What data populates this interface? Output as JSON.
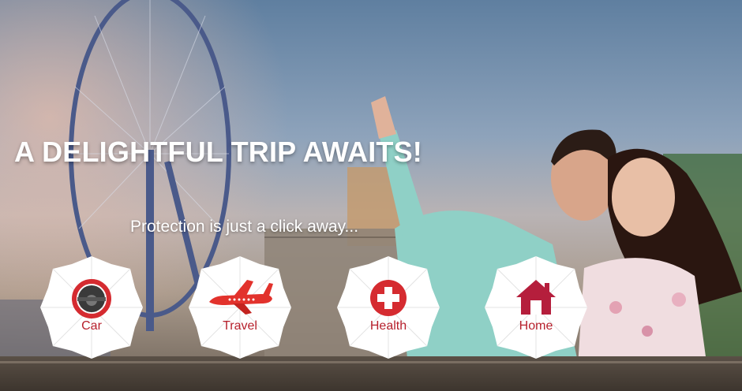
{
  "hero": {
    "headline": "A DELIGHTFUL TRIP AWAITS!",
    "subline": "Protection is just a click away..."
  },
  "products": [
    {
      "label": "Car",
      "icon": "steering-wheel-icon"
    },
    {
      "label": "Travel",
      "icon": "airplane-icon"
    },
    {
      "label": "Health",
      "icon": "health-cross-icon"
    },
    {
      "label": "Home",
      "icon": "house-icon"
    }
  ],
  "colors": {
    "label_red": "#b61f2b",
    "icon_red": "#d52b30",
    "umbrella_white": "#ffffff"
  }
}
